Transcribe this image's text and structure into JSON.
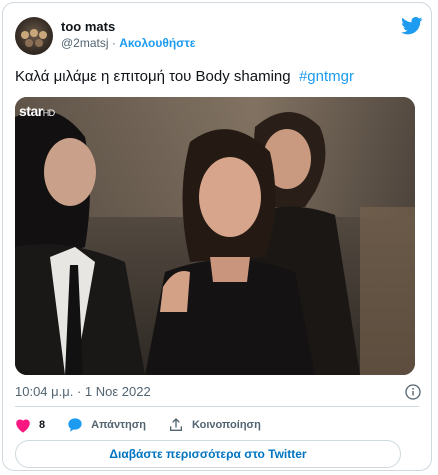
{
  "author": {
    "name": "too mats",
    "handle": "@2matsj",
    "separator": " · ",
    "follow_label": "Ακολουθήστε"
  },
  "tweet": {
    "text": "Καλά μιλάμε η επιτομή του Body shaming",
    "hashtag": "#gntmgr"
  },
  "media": {
    "channel_logo": "star",
    "channel_logo_suffix": "HD"
  },
  "timestamp": "10:04 μ.μ. · 1 Νοε 2022",
  "actions": {
    "likes_count": "8",
    "reply_label": "Απάντηση",
    "share_label": "Κοινοποίηση"
  },
  "read_more_label": "Διαβάστε περισσότερα στο Twitter",
  "colors": {
    "link": "#1d9bf0",
    "heart": "#f91880",
    "reply": "#1d9bf0",
    "read_more": "#0074c2",
    "muted": "#536471"
  },
  "icons": [
    "avatar",
    "twitter-bird-icon",
    "info-icon",
    "heart-icon",
    "reply-bubble-icon",
    "share-icon"
  ]
}
